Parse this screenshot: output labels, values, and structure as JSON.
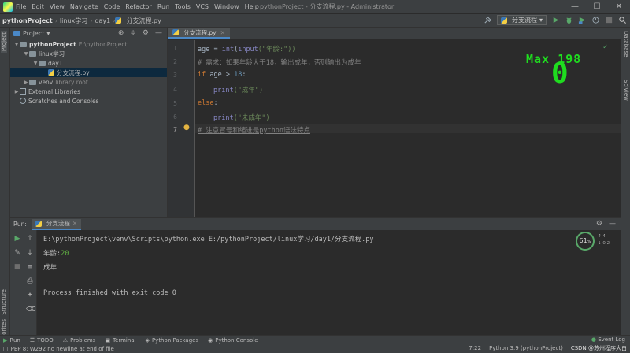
{
  "menu": [
    "File",
    "Edit",
    "View",
    "Navigate",
    "Code",
    "Refactor",
    "Run",
    "Tools",
    "VCS",
    "Window",
    "Help"
  ],
  "window_title": "pythonProject - 分支流程.py - Administrator",
  "breadcrumbs": [
    "pythonProject",
    "linux学习",
    "day1",
    "分支流程.py"
  ],
  "run_config": "分支流程",
  "project_panel": {
    "title": "Project",
    "tree": [
      {
        "label": "pythonProject",
        "note": "E:\\pythonProject",
        "depth": 0,
        "bold": true
      },
      {
        "label": "linux学习",
        "depth": 1
      },
      {
        "label": "day1",
        "depth": 2
      },
      {
        "label": "分支流程.py",
        "depth": 3
      },
      {
        "label": "venv",
        "note": "library root",
        "depth": 1
      },
      {
        "label": "External Libraries",
        "depth": 0
      },
      {
        "label": "Scratches and Consoles",
        "depth": 0
      }
    ]
  },
  "editor": {
    "tab": "分支流程.py",
    "line_numbers": [
      "1",
      "2",
      "3",
      "4",
      "5",
      "6",
      "7"
    ],
    "code": {
      "l1_id": "age = ",
      "l1_fn": "int",
      "l1_p": "(",
      "l1_fn2": "input",
      "l1_str": "(\"年龄:\"))",
      "l2": "# 需求：如果年龄大于18，输出成年，否则输出为成年",
      "l3_kw": "if",
      "l3_rest": " age > ",
      "l3_num": "18",
      "l3_colon": ":",
      "l4_fn": "print",
      "l4_str": "(\"成年\")",
      "l5_kw": "else",
      "l5_colon": ":",
      "l6_fn": "print",
      "l6_str": "(\"未成年\")",
      "l7": "# 注意冒号和缩进是python语法特点"
    }
  },
  "overlay": {
    "label": "Max 198",
    "value": "0"
  },
  "run_panel": {
    "label": "Run:",
    "tab": "分支流程",
    "cmd": "E:\\pythonProject\\venv\\Scripts\\python.exe E:/pythonProject/linux学习/day1/分支流程.py",
    "prompt": "年龄:",
    "input_value": "20",
    "result": "成年",
    "exit": "Process finished with exit code 0"
  },
  "perf": {
    "percent": "61",
    "unit": "%",
    "up": "4",
    "down": "0.2"
  },
  "bottom_tabs": [
    "Run",
    "TODO",
    "Problems",
    "Terminal",
    "Python Packages",
    "Python Console"
  ],
  "event_log": "Event Log",
  "left_tabs": [
    "Project",
    "Structure",
    "Favorites"
  ],
  "right_tabs": [
    "Database",
    "SciView"
  ],
  "status": {
    "message": "PEP 8: W292 no newline at end of file",
    "position": "7:22",
    "interpreter": "Python 3.9 (pythonProject)",
    "watermark": "CSDN @苏州程序大白"
  },
  "colors": {
    "accent": "#4a88c7",
    "overlay_green": "#1fdc1f"
  }
}
